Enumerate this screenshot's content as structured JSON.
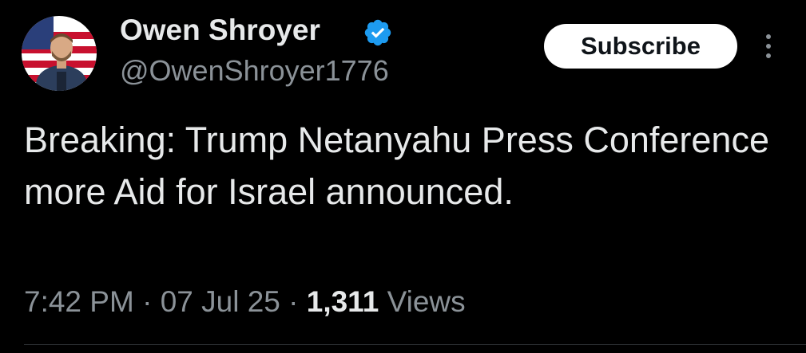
{
  "author": {
    "display_name": "Owen Shroyer",
    "handle": "@OwenShroyer1776",
    "verified_icon": "verified-badge-icon",
    "verified_color": "#1d9bf0"
  },
  "actions": {
    "subscribe_label": "Subscribe",
    "more_icon": "vertical-ellipsis-icon"
  },
  "tweet": {
    "text": "Breaking: Trump Netanyahu Press Conference more Aid for Israel announced.",
    "time": "7:42 PM",
    "separator": "·",
    "date": "07 Jul 25",
    "views_count": "1,311",
    "views_label": "Views"
  }
}
